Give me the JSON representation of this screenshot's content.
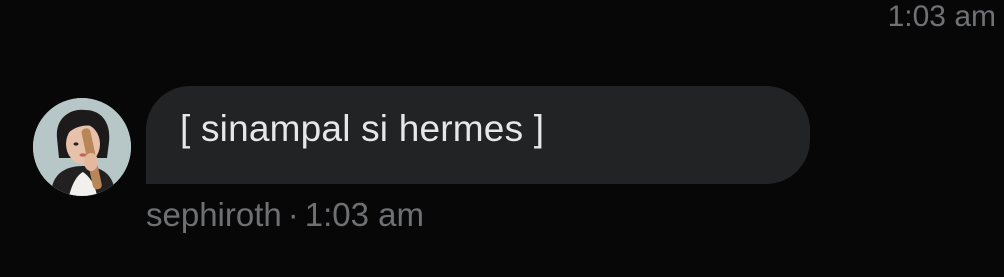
{
  "thread": {
    "top_timestamp": "1:03 am"
  },
  "message": {
    "text": "[ sinampal si hermes ]",
    "sender": "sephiroth",
    "separator": "·",
    "time": "1:03 am",
    "avatar_icon": "user-avatar-illustration"
  },
  "colors": {
    "background": "#070707",
    "bubble": "#212325",
    "text": "#e7e7e7",
    "muted": "#6e7074"
  }
}
